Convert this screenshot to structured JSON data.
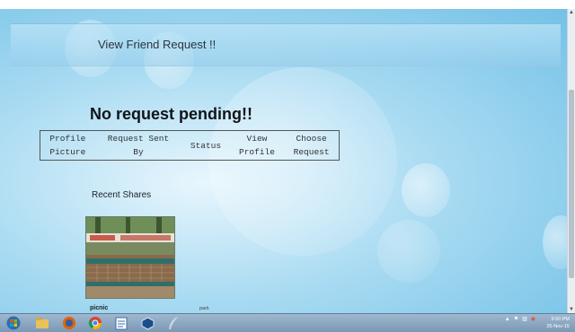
{
  "header": {
    "title": "View Friend Request !!"
  },
  "requests": {
    "empty_message": "No request pending!!",
    "columns": [
      [
        "Profile",
        "Picture"
      ],
      [
        "Request Sent",
        "By"
      ],
      [
        "Status"
      ],
      [
        "View",
        "Profile"
      ],
      [
        "Choose",
        "Request"
      ]
    ]
  },
  "recent_shares": {
    "title": "Recent Shares",
    "items": [
      {
        "caption": "picnic",
        "sub": "park"
      }
    ]
  },
  "taskbar": {
    "clock_time": "9:50 PM",
    "clock_date": "25-Nov-15",
    "apps": [
      "windows-start-icon",
      "file-explorer-icon",
      "firefox-icon",
      "chrome-icon",
      "notepad-icon",
      "virtualbox-icon",
      "feather-app-icon"
    ]
  }
}
